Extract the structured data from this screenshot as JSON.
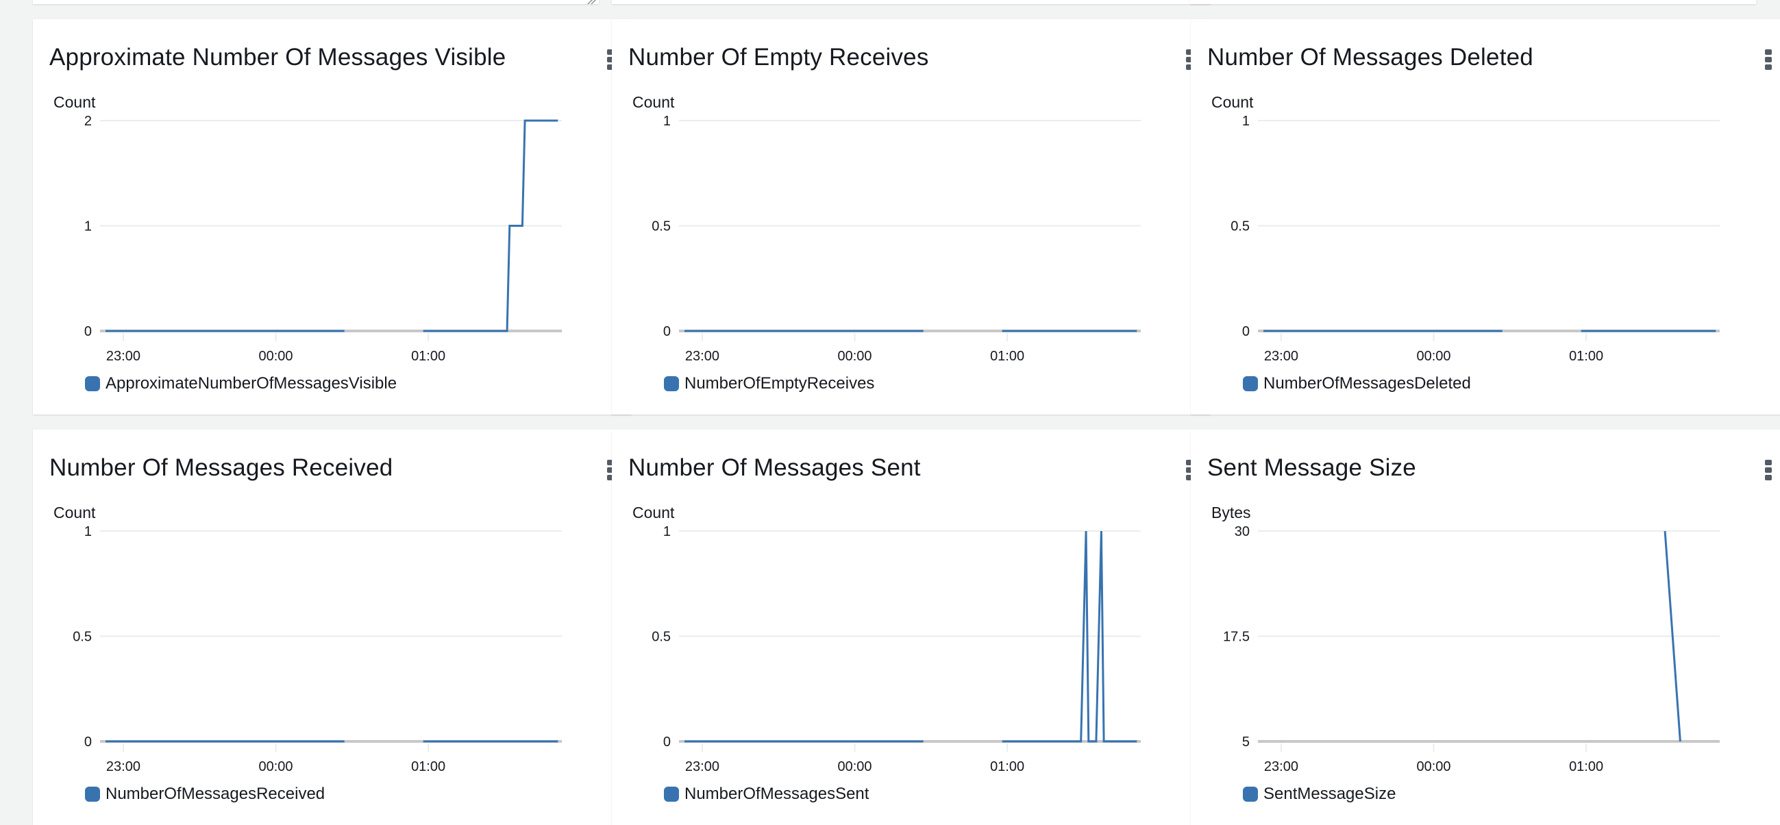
{
  "page": {
    "colors": {
      "series": "#3873b0",
      "gap": "#c8c8c8",
      "grid": "#eaeded",
      "menu_icon": "#545b64"
    }
  },
  "widgets": [
    {
      "title": "Approximate Number Of Messages Visible",
      "unit": "Count",
      "legend": "ApproximateNumberOfMessagesVisible",
      "menu_icon": "more-vertical-icon"
    },
    {
      "title": "Number Of Empty Receives",
      "unit": "Count",
      "legend": "NumberOfEmptyReceives",
      "menu_icon": "more-vertical-icon"
    },
    {
      "title": "Number Of Messages Deleted",
      "unit": "Count",
      "legend": "NumberOfMessagesDeleted",
      "menu_icon": "more-vertical-icon"
    },
    {
      "title": "Number Of Messages Received",
      "unit": "Count",
      "legend": "NumberOfMessagesReceived",
      "menu_icon": "more-vertical-icon"
    },
    {
      "title": "Number Of Messages Sent",
      "unit": "Count",
      "legend": "NumberOfMessagesSent",
      "menu_icon": "more-vertical-icon"
    },
    {
      "title": "Sent Message Size",
      "unit": "Bytes",
      "legend": "SentMessageSize",
      "menu_icon": "more-vertical-icon"
    }
  ],
  "chart_data": [
    {
      "type": "line",
      "title": "Approximate Number Of Messages Visible",
      "ylabel": "Count",
      "xlabel": "",
      "x_ticks": [
        "23:00",
        "00:00",
        "01:00"
      ],
      "x_range_minutes": [
        -7,
        172
      ],
      "ylim": [
        0,
        2
      ],
      "y_ticks": [
        "0",
        "1",
        "2"
      ],
      "grid": true,
      "legend_position": "bottom-left",
      "series": [
        {
          "name": "ApproximateNumberOfMessagesVisible",
          "segments": [
            {
              "points": [
                [
                  -7,
                  0
                ],
                [
                  87,
                  0
                ]
              ]
            },
            {
              "points": [
                [
                  118,
                  0
                ],
                [
                  151,
                  0
                ],
                [
                  152,
                  1
                ],
                [
                  157,
                  1
                ],
                [
                  158,
                  2
                ],
                [
                  171,
                  2
                ]
              ]
            }
          ]
        }
      ]
    },
    {
      "type": "line",
      "title": "Number Of Empty Receives",
      "ylabel": "Count",
      "xlabel": "",
      "x_ticks": [
        "23:00",
        "00:00",
        "01:00"
      ],
      "x_range_minutes": [
        -7,
        172
      ],
      "ylim": [
        0,
        1
      ],
      "y_ticks": [
        "0",
        "0.5",
        "1"
      ],
      "grid": true,
      "legend_position": "bottom-left",
      "series": [
        {
          "name": "NumberOfEmptyReceives",
          "segments": [
            {
              "points": [
                [
                  -7,
                  0
                ],
                [
                  87,
                  0
                ]
              ]
            },
            {
              "points": [
                [
                  118,
                  0
                ],
                [
                  171,
                  0
                ]
              ]
            }
          ]
        }
      ]
    },
    {
      "type": "line",
      "title": "Number Of Messages Deleted",
      "ylabel": "Count",
      "xlabel": "",
      "x_ticks": [
        "23:00",
        "00:00",
        "01:00"
      ],
      "x_range_minutes": [
        -7,
        172
      ],
      "ylim": [
        0,
        1
      ],
      "y_ticks": [
        "0",
        "0.5",
        "1"
      ],
      "grid": true,
      "legend_position": "bottom-left",
      "series": [
        {
          "name": "NumberOfMessagesDeleted",
          "segments": [
            {
              "points": [
                [
                  -7,
                  0
                ],
                [
                  87,
                  0
                ]
              ]
            },
            {
              "points": [
                [
                  118,
                  0
                ],
                [
                  171,
                  0
                ]
              ]
            }
          ]
        }
      ]
    },
    {
      "type": "line",
      "title": "Number Of Messages Received",
      "ylabel": "Count",
      "xlabel": "",
      "x_ticks": [
        "23:00",
        "00:00",
        "01:00"
      ],
      "x_range_minutes": [
        -7,
        172
      ],
      "ylim": [
        0,
        1
      ],
      "y_ticks": [
        "0",
        "0.5",
        "1"
      ],
      "grid": true,
      "legend_position": "bottom-left",
      "series": [
        {
          "name": "NumberOfMessagesReceived",
          "segments": [
            {
              "points": [
                [
                  -7,
                  0
                ],
                [
                  87,
                  0
                ]
              ]
            },
            {
              "points": [
                [
                  118,
                  0
                ],
                [
                  171,
                  0
                ]
              ]
            }
          ]
        }
      ]
    },
    {
      "type": "line",
      "title": "Number Of Messages Sent",
      "ylabel": "Count",
      "xlabel": "",
      "x_ticks": [
        "23:00",
        "00:00",
        "01:00"
      ],
      "x_range_minutes": [
        -7,
        172
      ],
      "ylim": [
        0,
        1
      ],
      "y_ticks": [
        "0",
        "0.5",
        "1"
      ],
      "grid": true,
      "legend_position": "bottom-left",
      "series": [
        {
          "name": "NumberOfMessagesSent",
          "segments": [
            {
              "points": [
                [
                  -7,
                  0
                ],
                [
                  87,
                  0
                ]
              ]
            },
            {
              "points": [
                [
                  118,
                  0
                ],
                [
                  149,
                  0
                ],
                [
                  151,
                  1
                ],
                [
                  152,
                  0
                ],
                [
                  155,
                  0
                ],
                [
                  157,
                  1
                ],
                [
                  158,
                  0
                ],
                [
                  171,
                  0
                ]
              ]
            }
          ]
        }
      ]
    },
    {
      "type": "line",
      "title": "Sent Message Size",
      "ylabel": "Bytes",
      "xlabel": "",
      "x_ticks": [
        "23:00",
        "00:00",
        "01:00"
      ],
      "x_range_minutes": [
        -7,
        172
      ],
      "ylim": [
        5,
        30
      ],
      "y_ticks": [
        "5",
        "17.5",
        "30"
      ],
      "grid": true,
      "legend_position": "bottom-left",
      "series": [
        {
          "name": "SentMessageSize",
          "segments": [
            {
              "points": [
                [
                  151,
                  30
                ],
                [
                  157,
                  5
                ]
              ]
            }
          ]
        }
      ]
    }
  ]
}
